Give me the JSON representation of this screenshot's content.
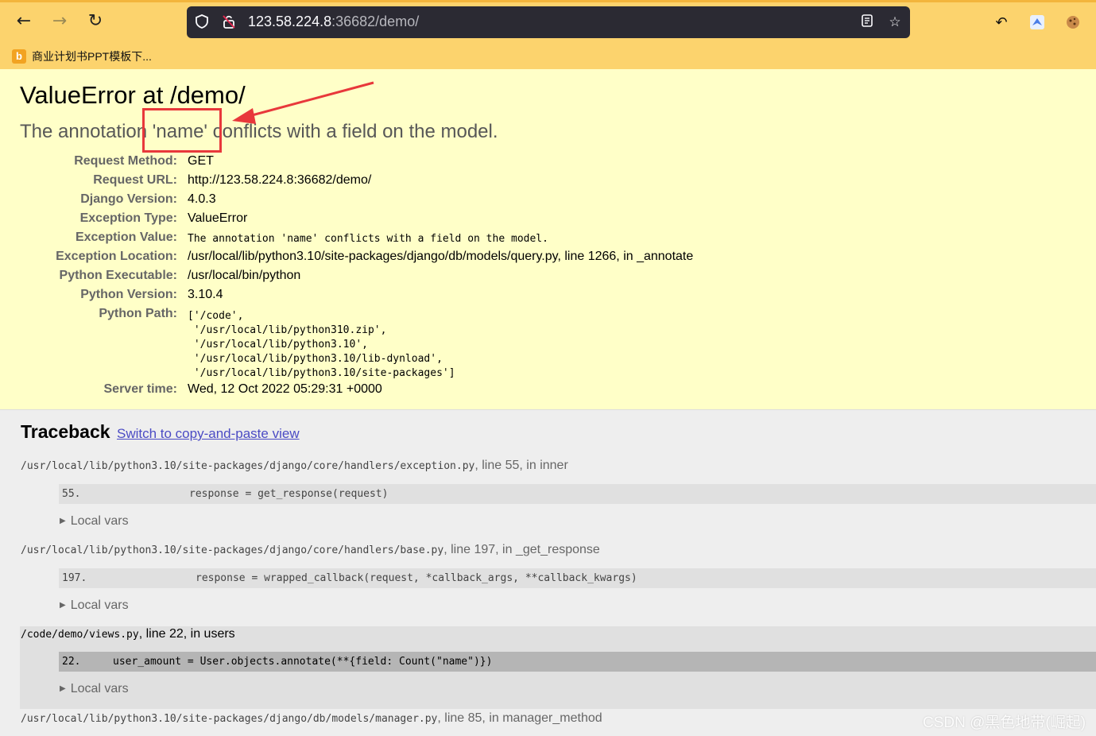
{
  "browser": {
    "url_host": "123.58.224.8",
    "url_port": ":36682",
    "url_path": "/demo/",
    "bookmark_label": "商业计划书PPT模板下...",
    "bookmark_icon_letter": "b"
  },
  "error": {
    "title": "ValueError at /demo/",
    "message": "The annotation 'name' conflicts with a field on the model."
  },
  "meta": [
    {
      "key": "Request Method:",
      "value": "GET"
    },
    {
      "key": "Request URL:",
      "value": "http://123.58.224.8:36682/demo/"
    },
    {
      "key": "Django Version:",
      "value": "4.0.3"
    },
    {
      "key": "Exception Type:",
      "value": "ValueError"
    },
    {
      "key": "Exception Value:",
      "value": "The annotation 'name' conflicts with a field on the model."
    },
    {
      "key": "Exception Location:",
      "value": "/usr/local/lib/python3.10/site-packages/django/db/models/query.py, line 1266, in _annotate"
    },
    {
      "key": "Python Executable:",
      "value": "/usr/local/bin/python"
    },
    {
      "key": "Python Version:",
      "value": "3.10.4"
    },
    {
      "key": "Python Path:",
      "value": "['/code',\n '/usr/local/lib/python310.zip',\n '/usr/local/lib/python3.10',\n '/usr/local/lib/python3.10/lib-dynload',\n '/usr/local/lib/python3.10/site-packages']"
    },
    {
      "key": "Server time:",
      "value": "Wed, 12 Oct 2022 05:29:31 +0000"
    }
  ],
  "traceback": {
    "title": "Traceback",
    "switch_link": "Switch to copy-and-paste view",
    "local_vars_label": "Local vars",
    "frames": [
      {
        "path": "/usr/local/lib/python3.10/site-packages/django/core/handlers/exception.py",
        "suffix": ", line 55, in inner",
        "lineno": "55.",
        "code": "response = get_response(request)"
      },
      {
        "path": "/usr/local/lib/python3.10/site-packages/django/core/handlers/base.py",
        "suffix": ", line 197, in _get_response",
        "lineno": "197.",
        "code": "response = wrapped_callback(request, *callback_args, **callback_kwargs)"
      },
      {
        "path": "/code/demo/views.py",
        "suffix": ", line 22, in users",
        "lineno": "22.",
        "code": "user_amount = User.objects.annotate(**{field: Count(\"name\")})"
      },
      {
        "path": "/usr/local/lib/python3.10/site-packages/django/db/models/manager.py",
        "suffix": ", line 85, in manager_method"
      }
    ]
  },
  "watermark": "CSDN @黑色地带(崛起)",
  "colors": {
    "toolbar": "#fcd36d",
    "summary_bg": "#ffffc8",
    "annotation_red": "#e8383b",
    "link": "#4b4bc4"
  }
}
